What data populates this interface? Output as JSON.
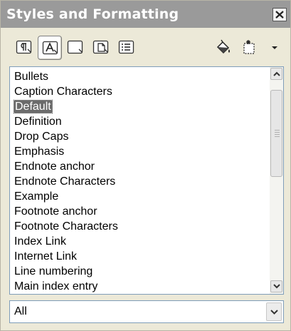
{
  "window": {
    "title": "Styles and Formatting"
  },
  "toolbar": {
    "buttons": [
      {
        "name": "paragraph-styles-button",
        "icon": "paragraph-styles-icon",
        "active": false
      },
      {
        "name": "character-styles-button",
        "icon": "character-styles-icon",
        "active": true
      },
      {
        "name": "frame-styles-button",
        "icon": "frame-styles-icon",
        "active": false
      },
      {
        "name": "page-styles-button",
        "icon": "page-styles-icon",
        "active": false
      },
      {
        "name": "list-styles-button",
        "icon": "list-styles-icon",
        "active": false
      },
      {
        "name": "fill-format-mode-button",
        "icon": "paint-bucket-icon",
        "active": false
      },
      {
        "name": "new-style-from-selection-button",
        "icon": "new-style-icon",
        "active": false
      }
    ]
  },
  "style_list": {
    "items": [
      "Bullets",
      "Caption Characters",
      "Default",
      "Definition",
      "Drop Caps",
      "Emphasis",
      "Endnote anchor",
      "Endnote Characters",
      "Example",
      "Footnote anchor",
      "Footnote Characters",
      "Index Link",
      "Internet Link",
      "Line numbering",
      "Main index entry"
    ],
    "selected": "Default"
  },
  "filter": {
    "value": "All"
  },
  "colors": {
    "titlebar": "#9a9a9a",
    "window_bg": "#ece9d8",
    "selection": "#6b6b6b",
    "border": "#7f9db9"
  }
}
